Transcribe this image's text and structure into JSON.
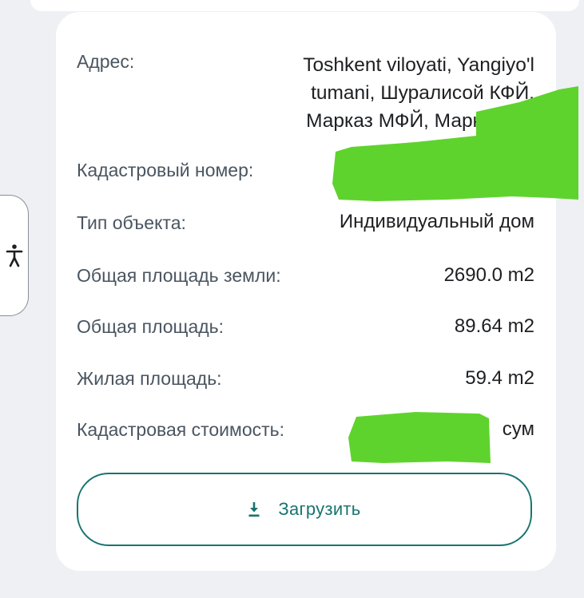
{
  "address": {
    "label": "Адрес:",
    "value_lines": [
      "Toshkent viloyati, Yangiyo'l",
      "tumani, Шуралисой  КФЙ,",
      "Марказ МФЙ, Марказ, до"
    ]
  },
  "cadastral_number": {
    "label": "Кадастровый номер:",
    "value_redacted": true
  },
  "object_type": {
    "label": "Тип объекта:",
    "value": "Индивидуальный дом"
  },
  "total_land_area": {
    "label": "Общая площадь земли:",
    "value": "2690.0 m2"
  },
  "total_area": {
    "label": "Общая площадь:",
    "value": "89.64 m2"
  },
  "living_area": {
    "label": "Жилая площадь:",
    "value": "59.4 m2"
  },
  "cadastral_value": {
    "label": "Кадастровая стоимость:",
    "currency": "сум",
    "value_redacted": true
  },
  "download_button": {
    "label": "Загрузить",
    "icon": "download-icon"
  },
  "accessibility": {
    "icon": "accessibility-icon"
  },
  "colors": {
    "accent": "#17746f",
    "redaction": "#5fd32d",
    "label_text": "#4a5560",
    "value_text": "#1d1f22",
    "background": "#eef0f3"
  }
}
